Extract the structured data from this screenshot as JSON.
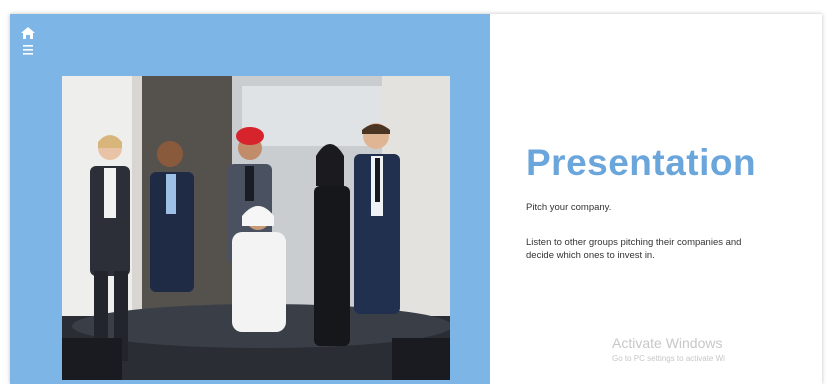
{
  "nav": {
    "home_icon": "home-icon",
    "menu_icon": "hamburger-menu-icon"
  },
  "slide": {
    "title": "Presentation",
    "subtitle": "Pitch your company.",
    "body": "Listen to other groups pitching their companies and decide which ones to invest in.",
    "photo": "group-of-business-people-photo"
  },
  "watermark": {
    "title": "Activate Windows",
    "subtitle": "Go to PC settings to activate Wi"
  },
  "colors": {
    "panel": "#7cb5e6",
    "title": "#6aa6db",
    "background": "#ffffff"
  }
}
